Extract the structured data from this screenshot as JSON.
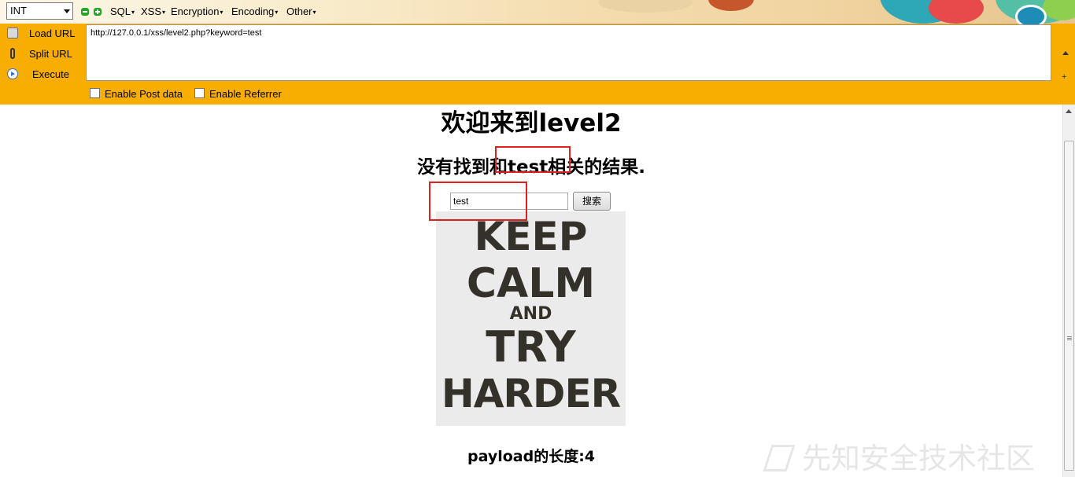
{
  "hackbar": {
    "select_value": "INT",
    "menus": [
      "SQL",
      "XSS",
      "Encryption",
      "Encoding",
      "Other"
    ],
    "load_url_label": "Load URL",
    "split_url_label": "Split URL",
    "execute_label": "Execute",
    "url_value": "http://127.0.0.1/xss/level2.php?keyword=test",
    "post_data_label": "Enable Post data",
    "referrer_label": "Enable Referrer"
  },
  "page": {
    "title": "欢迎来到level2",
    "result_text": "没有找到和test相关的结果.",
    "search_value": "test",
    "search_button": "搜索",
    "poster_lines": [
      "KEEP",
      "CALM",
      "AND",
      "TRY",
      "HARDER"
    ],
    "payload_text": "payload的长度:4"
  },
  "watermark": "先知安全技术社区",
  "colors": {
    "toolbar_bg": "#f8ae00",
    "annotation_red": "#e02020",
    "poster_bg": "#ebebeb",
    "poster_text": "#33312a"
  },
  "icons": [
    "load-url-icon",
    "split-url-icon",
    "execute-icon",
    "decrease-icon",
    "increase-icon"
  ]
}
